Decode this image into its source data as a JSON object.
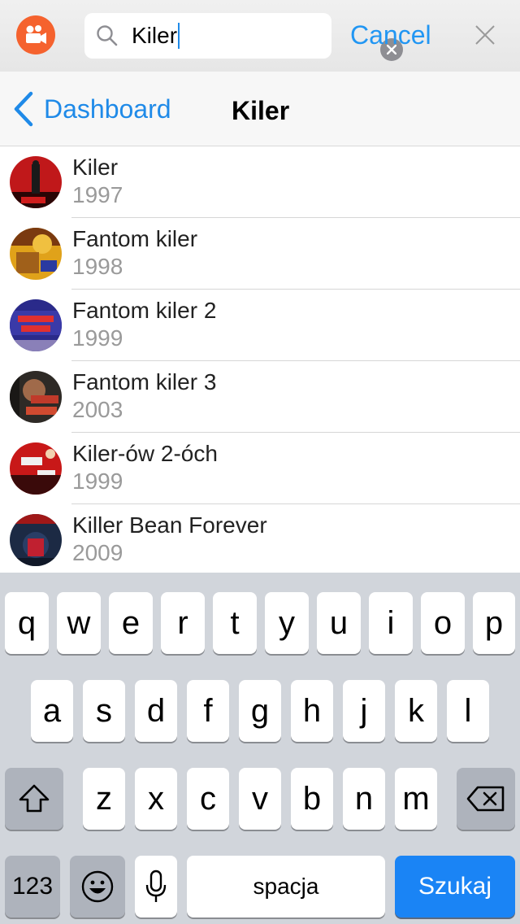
{
  "search": {
    "value": "Kiler",
    "cancel_label": "Cancel"
  },
  "nav": {
    "back_label": "Dashboard",
    "title": "Kiler"
  },
  "results": [
    {
      "title": "Kiler",
      "year": "1997"
    },
    {
      "title": "Fantom kiler",
      "year": "1998"
    },
    {
      "title": "Fantom kiler 2",
      "year": "1999"
    },
    {
      "title": "Fantom kiler 3",
      "year": "2003"
    },
    {
      "title": "Kiler-ów 2-óch",
      "year": "1999"
    },
    {
      "title": "Killer Bean Forever",
      "year": "2009"
    }
  ],
  "keyboard": {
    "row1": [
      "q",
      "w",
      "e",
      "r",
      "t",
      "y",
      "u",
      "i",
      "o",
      "p"
    ],
    "row2": [
      "a",
      "s",
      "d",
      "f",
      "g",
      "h",
      "j",
      "k",
      "l"
    ],
    "row3": [
      "z",
      "x",
      "c",
      "v",
      "b",
      "n",
      "m"
    ],
    "numbers_label": "123",
    "space_label": "spacja",
    "go_label": "Szukaj"
  },
  "colors": {
    "accent": "#1f8ae8",
    "app_icon": "#f5622e",
    "go_key": "#1a84f5"
  }
}
